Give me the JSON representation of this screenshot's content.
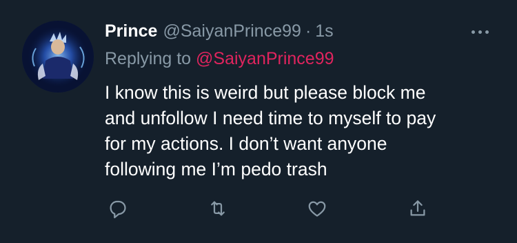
{
  "tweet": {
    "author_name": "Prince",
    "author_handle": "@SaiyanPrince99",
    "separator": "·",
    "timestamp": "1s",
    "replying_prefix": "Replying to",
    "replying_to": "@SaiyanPrince99",
    "text": "I know this is weird but please block me\nand unfollow I need time to myself to pay\nfor my actions. I don’t want anyone\nfollowing me I’m pedo trash"
  },
  "icons": {
    "avatar": "avatar-anime-character",
    "more": "more-dots-icon",
    "reply": "reply-icon",
    "retweet": "retweet-icon",
    "like": "heart-icon",
    "share": "share-icon"
  },
  "colors": {
    "background": "#15202b",
    "primary_text": "#ffffff",
    "secondary_text": "#8899a6",
    "mention": "#e0245e"
  }
}
